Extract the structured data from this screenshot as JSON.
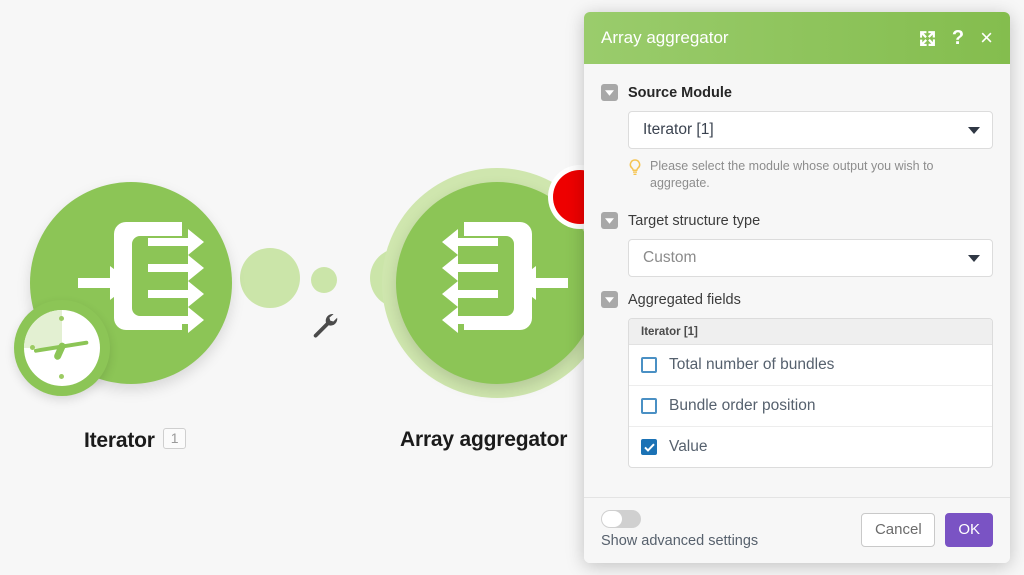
{
  "canvas": {
    "modules": [
      {
        "name": "Iterator",
        "badge": "1",
        "icon": "iterator-split-icon",
        "clock_badge": "clock-icon"
      },
      {
        "name": "Array aggregator",
        "icon": "aggregator-merge-icon",
        "error_badge": "error-dot"
      }
    ],
    "wrench": "wrench-icon",
    "link_dot": "connection-dot"
  },
  "dialog": {
    "title": "Array aggregator",
    "header_icons": {
      "expand": "expand-icon",
      "help": "?",
      "close": "×"
    },
    "fields": {
      "source_module": {
        "label": "Source Module",
        "value": "Iterator [1]",
        "hint": "Please select the module whose output you wish to aggregate.",
        "hint_icon": "lightbulb-icon"
      },
      "target_structure_type": {
        "label": "Target structure type",
        "value": "Custom"
      },
      "aggregated_fields": {
        "label": "Aggregated fields",
        "group_header": "Iterator [1]",
        "items": [
          {
            "label": "Total number of bundles",
            "checked": false
          },
          {
            "label": "Bundle order position",
            "checked": false
          },
          {
            "label": "Value",
            "checked": true
          }
        ]
      }
    },
    "footer": {
      "advanced_label": "Show advanced settings",
      "advanced_on": false,
      "cancel_label": "Cancel",
      "ok_label": "OK"
    }
  },
  "colors": {
    "module_green": "#8cc556",
    "halo_green": "#cfe6ae",
    "header_green_light": "#9acc6c",
    "header_green_dark": "#84bd4e",
    "checkbox_blue": "#1b72b5",
    "ok_purple": "#7a53c4",
    "error_red": "#ee0000",
    "hint_yellow": "#f5c451"
  }
}
